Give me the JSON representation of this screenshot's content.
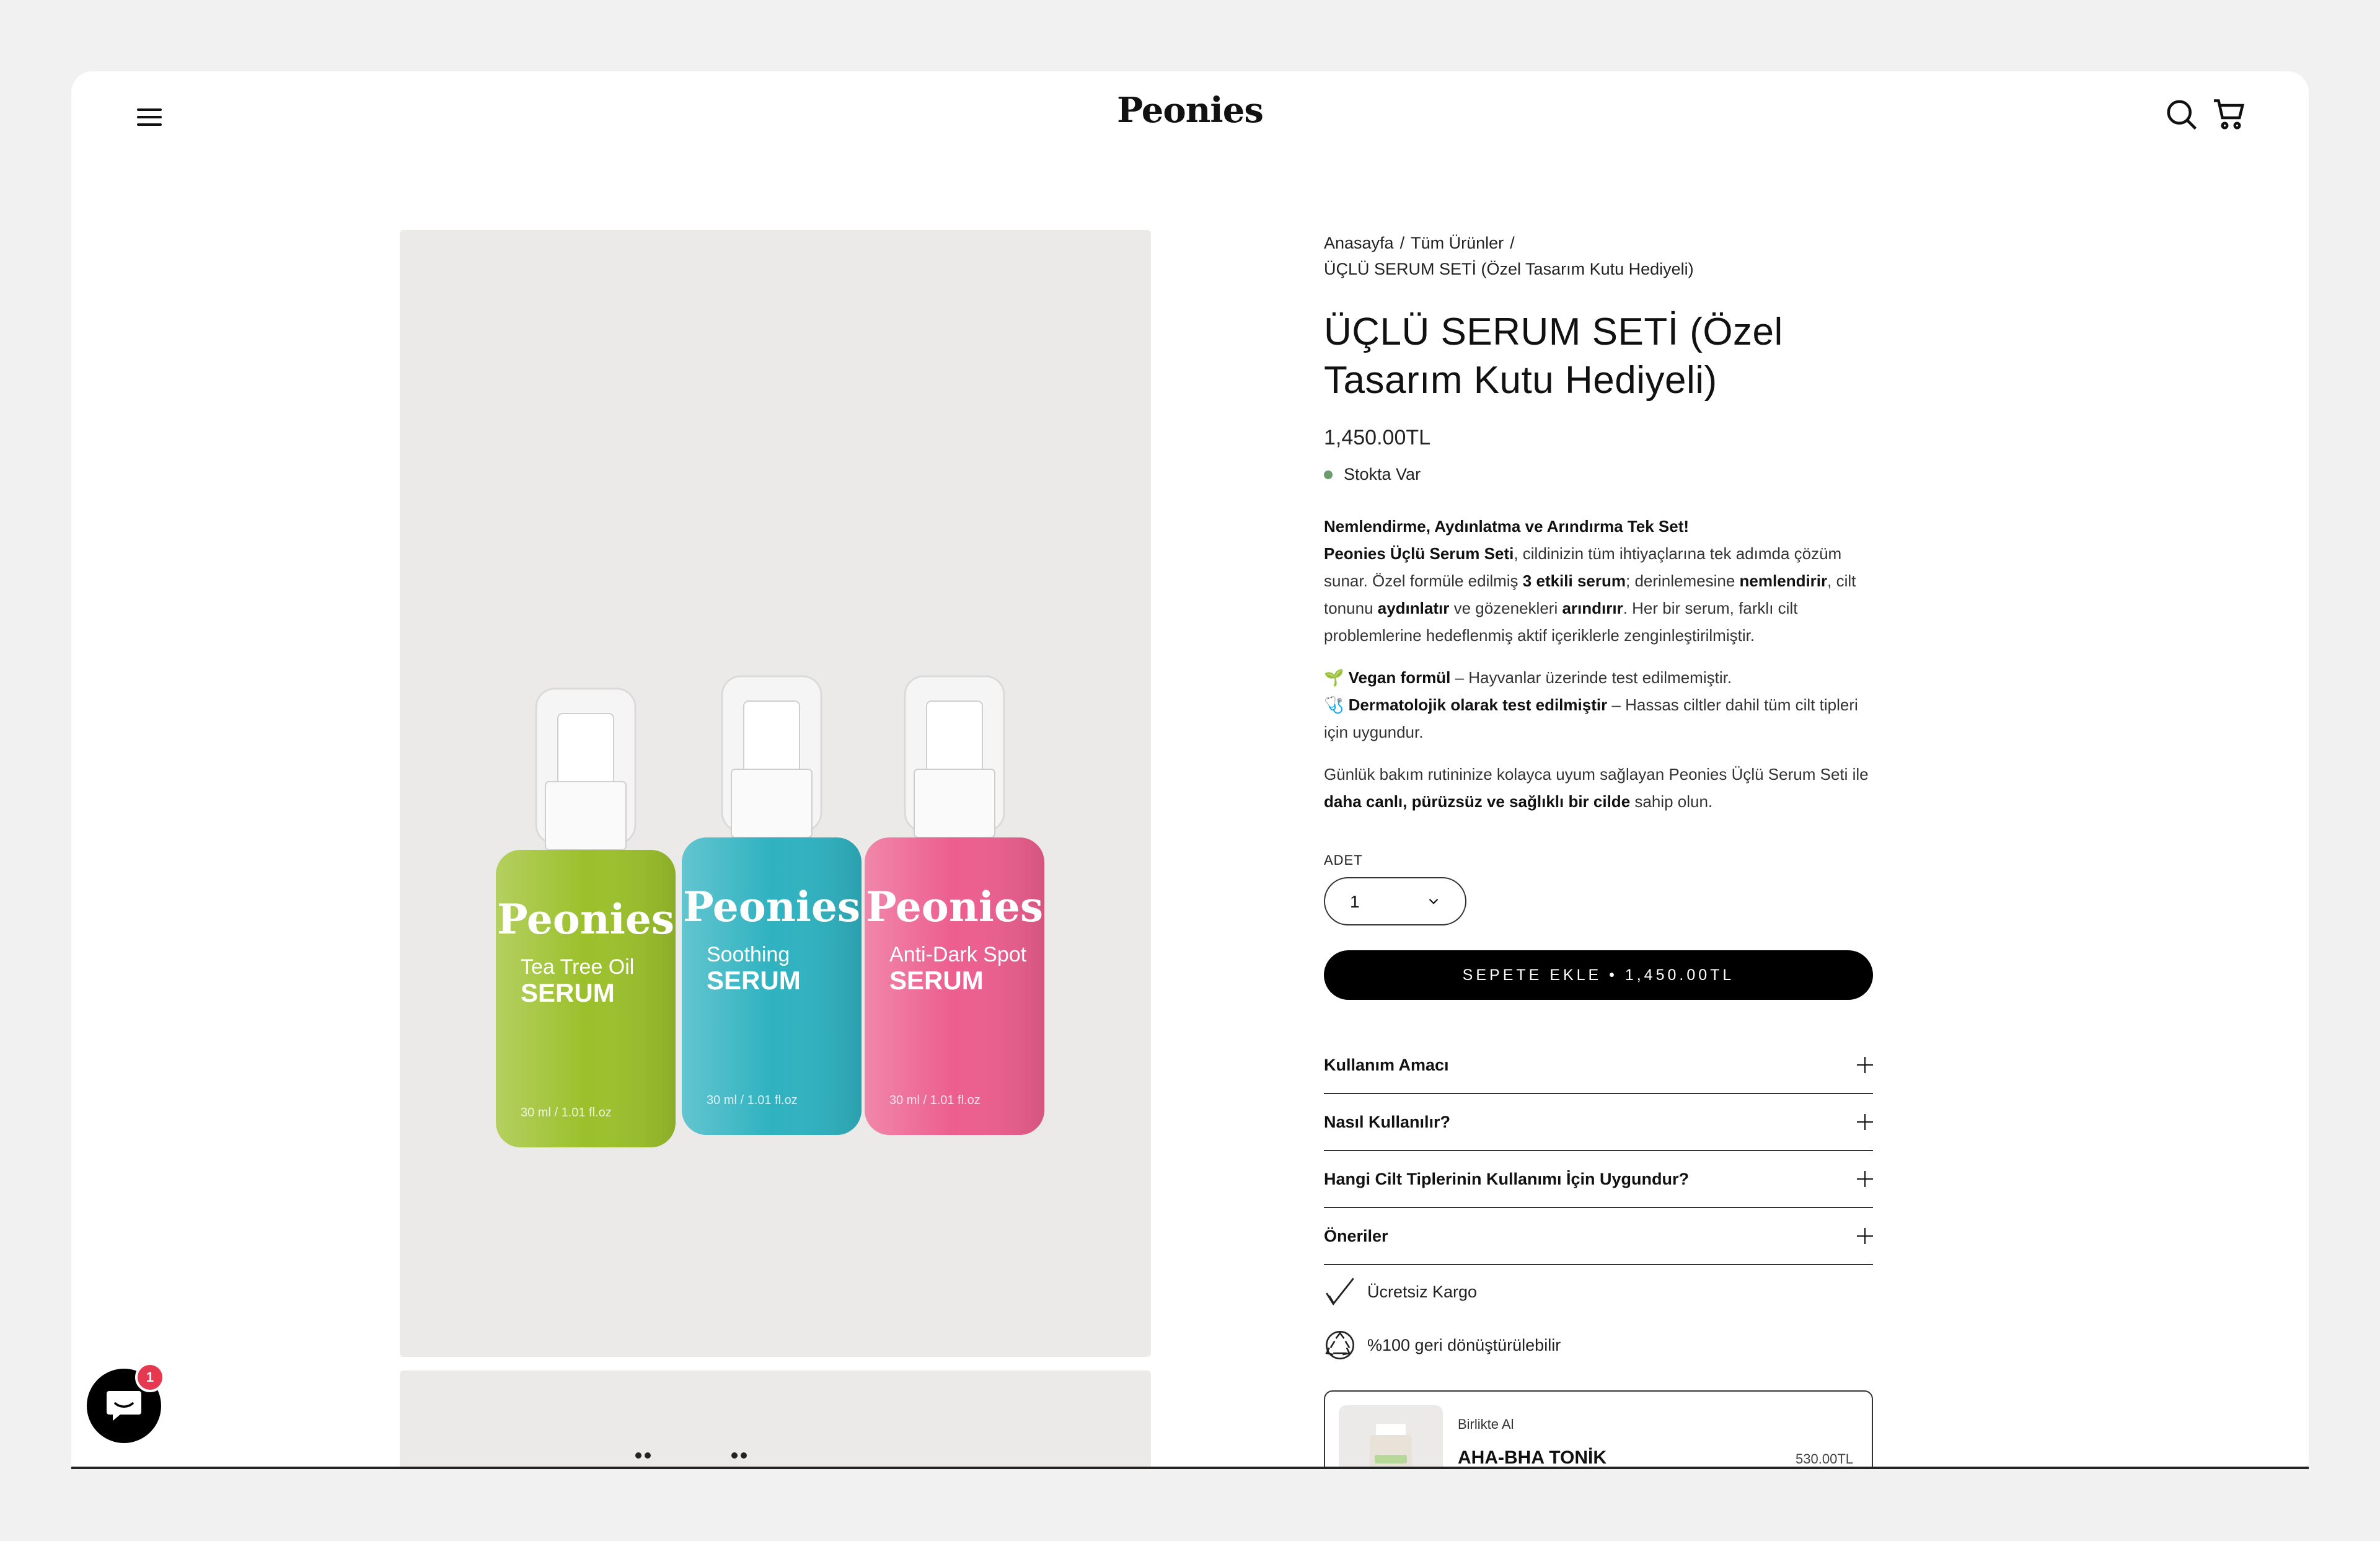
{
  "header": {
    "logo": "Peonies",
    "menu_icon": "hamburger-icon",
    "search_icon": "search-icon",
    "cart_icon": "cart-icon"
  },
  "gallery": {
    "bottle_brand": "Peonies",
    "bottles": [
      {
        "line1": "Tea Tree Oil",
        "line2": "SERUM",
        "volume": "30 ml / 1.01 fl.oz",
        "color": "#9bc02b"
      },
      {
        "line1": "Soothing",
        "line2": "SERUM",
        "volume": "30 ml / 1.01 fl.oz",
        "color": "#2fb2c0"
      },
      {
        "line1": "Anti-Dark Spot",
        "line2": "SERUM",
        "volume": "30 ml / 1.01 fl.oz",
        "color": "#ec5e8e"
      }
    ]
  },
  "breadcrumb": {
    "home": "Anasayfa",
    "all": "Tüm Ürünler",
    "current": "ÜÇLÜ SERUM SETİ (Özel Tasarım Kutu Hediyeli)"
  },
  "product": {
    "title": "ÜÇLÜ SERUM SETİ (Özel Tasarım Kutu Hediyeli)",
    "price": "1,450.00TL",
    "stock": "Stokta Var",
    "stock_color": "#6c9b6e"
  },
  "description": {
    "headline": "Nemlendirme, Aydınlatma ve Arındırma Tek Set!",
    "p1_a": "Peonies Üçlü Serum Seti",
    "p1_b": ", cildinizin tüm ihtiyaçlarına tek adımda çözüm sunar. Özel formüle edilmiş ",
    "p1_c": "3 etkili serum",
    "p1_d": "; derinlemesine ",
    "p1_e": "nemlendirir",
    "p1_f": ", cilt tonunu ",
    "p1_g": "aydınlatır",
    "p1_h": " ve gözenekleri ",
    "p1_i": "arındırır",
    "p1_j": ". Her bir serum, farklı cilt problemlerine hedeflenmiş aktif içeriklerle zenginleştirilmiştir.",
    "vegan_icon": "🌱",
    "vegan_b": "Vegan formül",
    "vegan_t": " – Hayvanlar üzerinde test edilmemiştir.",
    "derm_icon": "🩺",
    "derm_b": "Dermatolojik olarak test edilmiştir",
    "derm_t": " – Hassas ciltler dahil tüm cilt tipleri için uygundur.",
    "p3_a": "Günlük bakım rutininize kolayca uyum sağlayan Peonies Üçlü Serum Seti ile ",
    "p3_b": "daha canlı, pürüzsüz ve sağlıklı bir cilde",
    "p3_c": " sahip olun."
  },
  "quantity": {
    "label": "ADET",
    "value": "1"
  },
  "add_to_cart": "SEPETE EKLE • 1,450.00TL",
  "accordion": [
    {
      "label": "Kullanım Amacı"
    },
    {
      "label": "Nasıl Kullanılır?"
    },
    {
      "label": "Hangi Cilt Tiplerinin Kullanımı İçin Uygundur?"
    },
    {
      "label": "Öneriler"
    }
  ],
  "features": [
    {
      "label": "Ücretsiz Kargo",
      "icon": "checkmark-icon"
    },
    {
      "label": "%100 geri dönüştürülebilir",
      "icon": "recycle-icon"
    }
  ],
  "upsell": {
    "label": "Birlikte Al",
    "name": "AHA-BHA TONİK",
    "price": "530.00TL"
  },
  "chat": {
    "badge": "1"
  }
}
